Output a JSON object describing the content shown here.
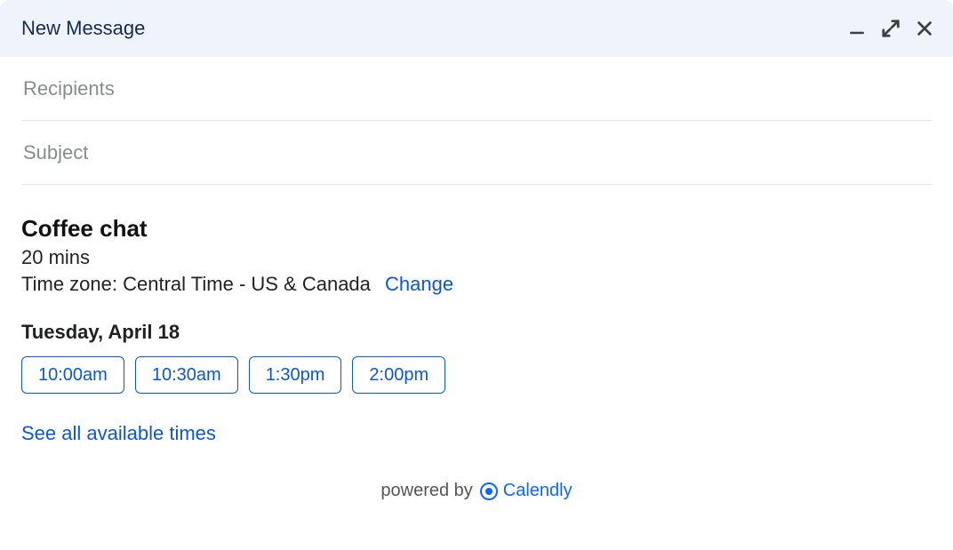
{
  "titlebar": {
    "title": "New Message"
  },
  "fields": {
    "recipients_placeholder": "Recipients",
    "recipients_value": "",
    "subject_placeholder": "Subject",
    "subject_value": ""
  },
  "event": {
    "title": "Coffee chat",
    "duration": "20 mins",
    "timezone_prefix": "Time zone: ",
    "timezone_value": "Central Time - US & Canada",
    "change_label": "Change"
  },
  "availability": {
    "date_heading": "Tuesday, April 18",
    "slots": [
      "10:00am",
      "10:30am",
      "1:30pm",
      "2:00pm"
    ],
    "see_all_label": "See all available times"
  },
  "footer": {
    "powered_by_prefix": "powered by",
    "brand": "Calendly"
  }
}
